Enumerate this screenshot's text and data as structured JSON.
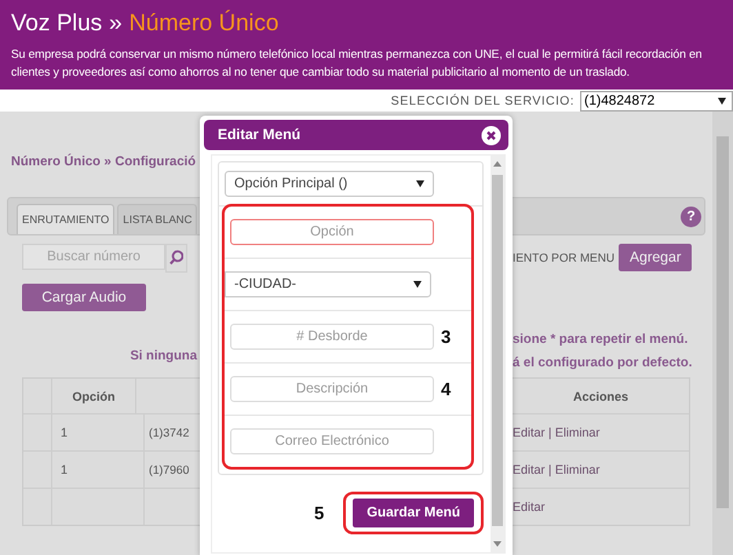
{
  "header": {
    "brand": "Voz Plus",
    "separator": "»",
    "section": "Número Único",
    "description": "Su empresa podrá conservar un mismo número telefónico local mientras permanezca con UNE, el cual le permitirá fácil recordación en clientes y proveedores así como ahorros al no tener que cambiar todo su material publicitario al momento de un traslado."
  },
  "service": {
    "label": "SELECCIÓN DEL SERVICIO:",
    "value": "(1)4824872"
  },
  "breadcrumb": "Número Único » Configuració",
  "tabs": [
    {
      "label": "ENRUTAMIENTO",
      "selected": true
    },
    {
      "label": "LISTA BLANC",
      "selected": false
    }
  ],
  "help": "?",
  "search": {
    "placeholder": "Buscar número"
  },
  "upload_button": "Cargar Audio",
  "routing_label": "IENTO POR MENU",
  "add_button": "Agregar",
  "notes": {
    "left": "Si ninguna",
    "right": [
      "sione * para repetir el menú.",
      "á el configurado por defecto."
    ]
  },
  "table": {
    "columns": [
      "Opción",
      "Acciones"
    ],
    "rows": [
      {
        "option": "1",
        "number": "(1)3742",
        "actions": "Editar | Eliminar"
      },
      {
        "option": "1",
        "number": "(1)7960",
        "actions": "Editar | Eliminar"
      },
      {
        "actions": "Editar"
      }
    ]
  },
  "modal": {
    "title": "Editar Menú",
    "selector": {
      "value": "Opción Principal ()"
    },
    "highlighted_fields": [
      {
        "kind": "input",
        "placeholder": "Opción",
        "invalid": true
      },
      {
        "kind": "select",
        "value": "-CIUDAD-"
      },
      {
        "kind": "input",
        "placeholder": "# Desborde",
        "invalid": false,
        "marker": "3"
      },
      {
        "kind": "input",
        "placeholder": "Descripción",
        "invalid": false,
        "marker": "4"
      },
      {
        "kind": "input",
        "placeholder": "Correo Electrónico",
        "invalid": false
      }
    ],
    "save_button": {
      "label": "Guardar Menú",
      "marker": "5",
      "highlighted": true
    }
  }
}
